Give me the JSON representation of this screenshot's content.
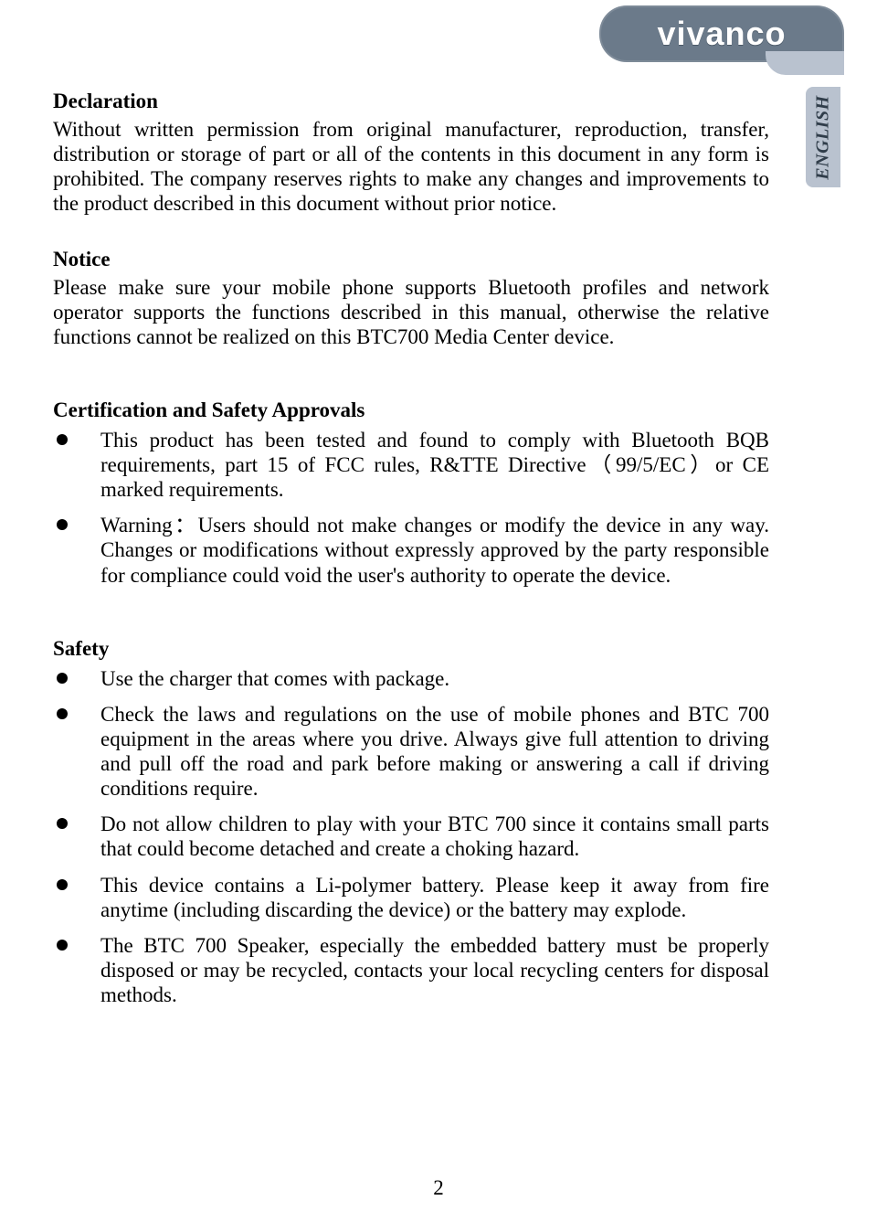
{
  "brand": "vivanco",
  "language_tab": "ENGLISH",
  "page_number": "2",
  "declaration": {
    "heading": "Declaration",
    "p1": "Without written permission from original manufacturer, reproduction, transfer, distribution or storage of part or all of the contents in this document in any form is prohibited. The company reserves rights to make any changes and improvements to the product described in this document without prior notice."
  },
  "notice": {
    "heading": "Notice",
    "p1": "Please make sure your mobile phone supports Bluetooth profiles and network operator supports the functions described in this manual, otherwise the relative functions cannot be realized on this BTC700 Media Center device."
  },
  "cert": {
    "heading": "Certification and Safety Approvals",
    "items": [
      "This product has been tested and found to comply with Bluetooth BQB requirements, part 15 of FCC rules, R&TTE Directive（99/5/EC）or CE marked requirements.",
      "Warning：Users should not make changes or modify the device in any way. Changes or modifications without expressly approved by the party responsible for compliance could void the user's authority to operate the device."
    ]
  },
  "safety": {
    "heading": "Safety",
    "items": [
      "Use the charger that comes with package.",
      "Check the laws and regulations on the use of mobile phones and BTC 700 equipment in the areas where you drive. Always give full attention to driving and pull off the road and park before making or answering a call if driving conditions require.",
      "Do not allow children to play with your BTC 700 since it contains small parts that could become detached and create a choking hazard.",
      "This device contains a Li-polymer battery. Please keep it away from fire anytime (including discarding the device) or the battery may explode.",
      "The BTC 700 Speaker, especially the embedded battery must be properly disposed or may be recycled, contacts your local recycling centers for disposal methods."
    ]
  }
}
